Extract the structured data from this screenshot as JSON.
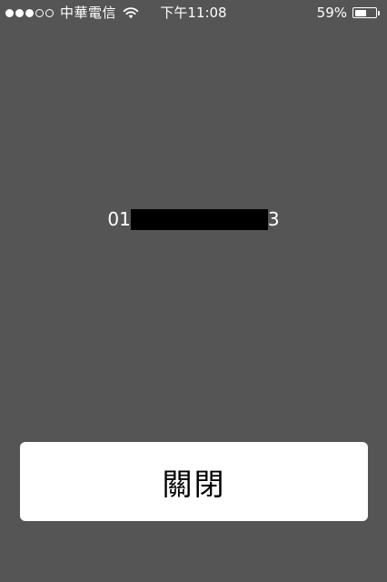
{
  "status_bar": {
    "signal_filled": 3,
    "signal_total": 5,
    "carrier": "中華電信",
    "time": "下午11:08",
    "battery_percent_label": "59%",
    "battery_level": 0.59,
    "wifi_icon": "wifi-icon"
  },
  "main": {
    "number_prefix": "01",
    "number_suffix": "3",
    "redacted": true
  },
  "actions": {
    "close_label": "關閉"
  },
  "colors": {
    "background": "#555555",
    "button_bg": "#ffffff",
    "button_text": "#000000",
    "redaction": "#000000"
  }
}
